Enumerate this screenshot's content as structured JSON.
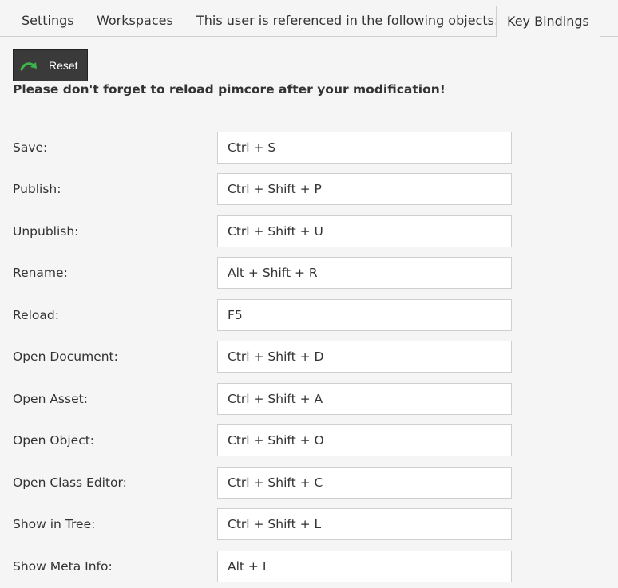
{
  "tabs": [
    {
      "label": "Settings",
      "active": false
    },
    {
      "label": "Workspaces",
      "active": false
    },
    {
      "label": "This user is referenced in the following objects:",
      "active": false
    },
    {
      "label": "Key Bindings",
      "active": true
    }
  ],
  "toolbar": {
    "reset_label": "Reset",
    "reset_icon": "redo-arrow-icon",
    "reset_icon_color": "#3bb54a"
  },
  "notice": "Please don't forget to reload pimcore after your modification!",
  "bindings": [
    {
      "label": "Save:",
      "value": "Ctrl + S"
    },
    {
      "label": "Publish:",
      "value": "Ctrl + Shift + P"
    },
    {
      "label": "Unpublish:",
      "value": "Ctrl + Shift + U"
    },
    {
      "label": "Rename:",
      "value": "Alt + Shift + R"
    },
    {
      "label": "Reload:",
      "value": "F5"
    },
    {
      "label": "Open Document:",
      "value": "Ctrl + Shift + D"
    },
    {
      "label": "Open Asset:",
      "value": "Ctrl + Shift + A"
    },
    {
      "label": "Open Object:",
      "value": "Ctrl + Shift + O"
    },
    {
      "label": "Open Class Editor:",
      "value": "Ctrl + Shift + C"
    },
    {
      "label": "Show in Tree:",
      "value": "Ctrl + Shift + L"
    },
    {
      "label": "Show Meta Info:",
      "value": "Alt + I"
    }
  ]
}
